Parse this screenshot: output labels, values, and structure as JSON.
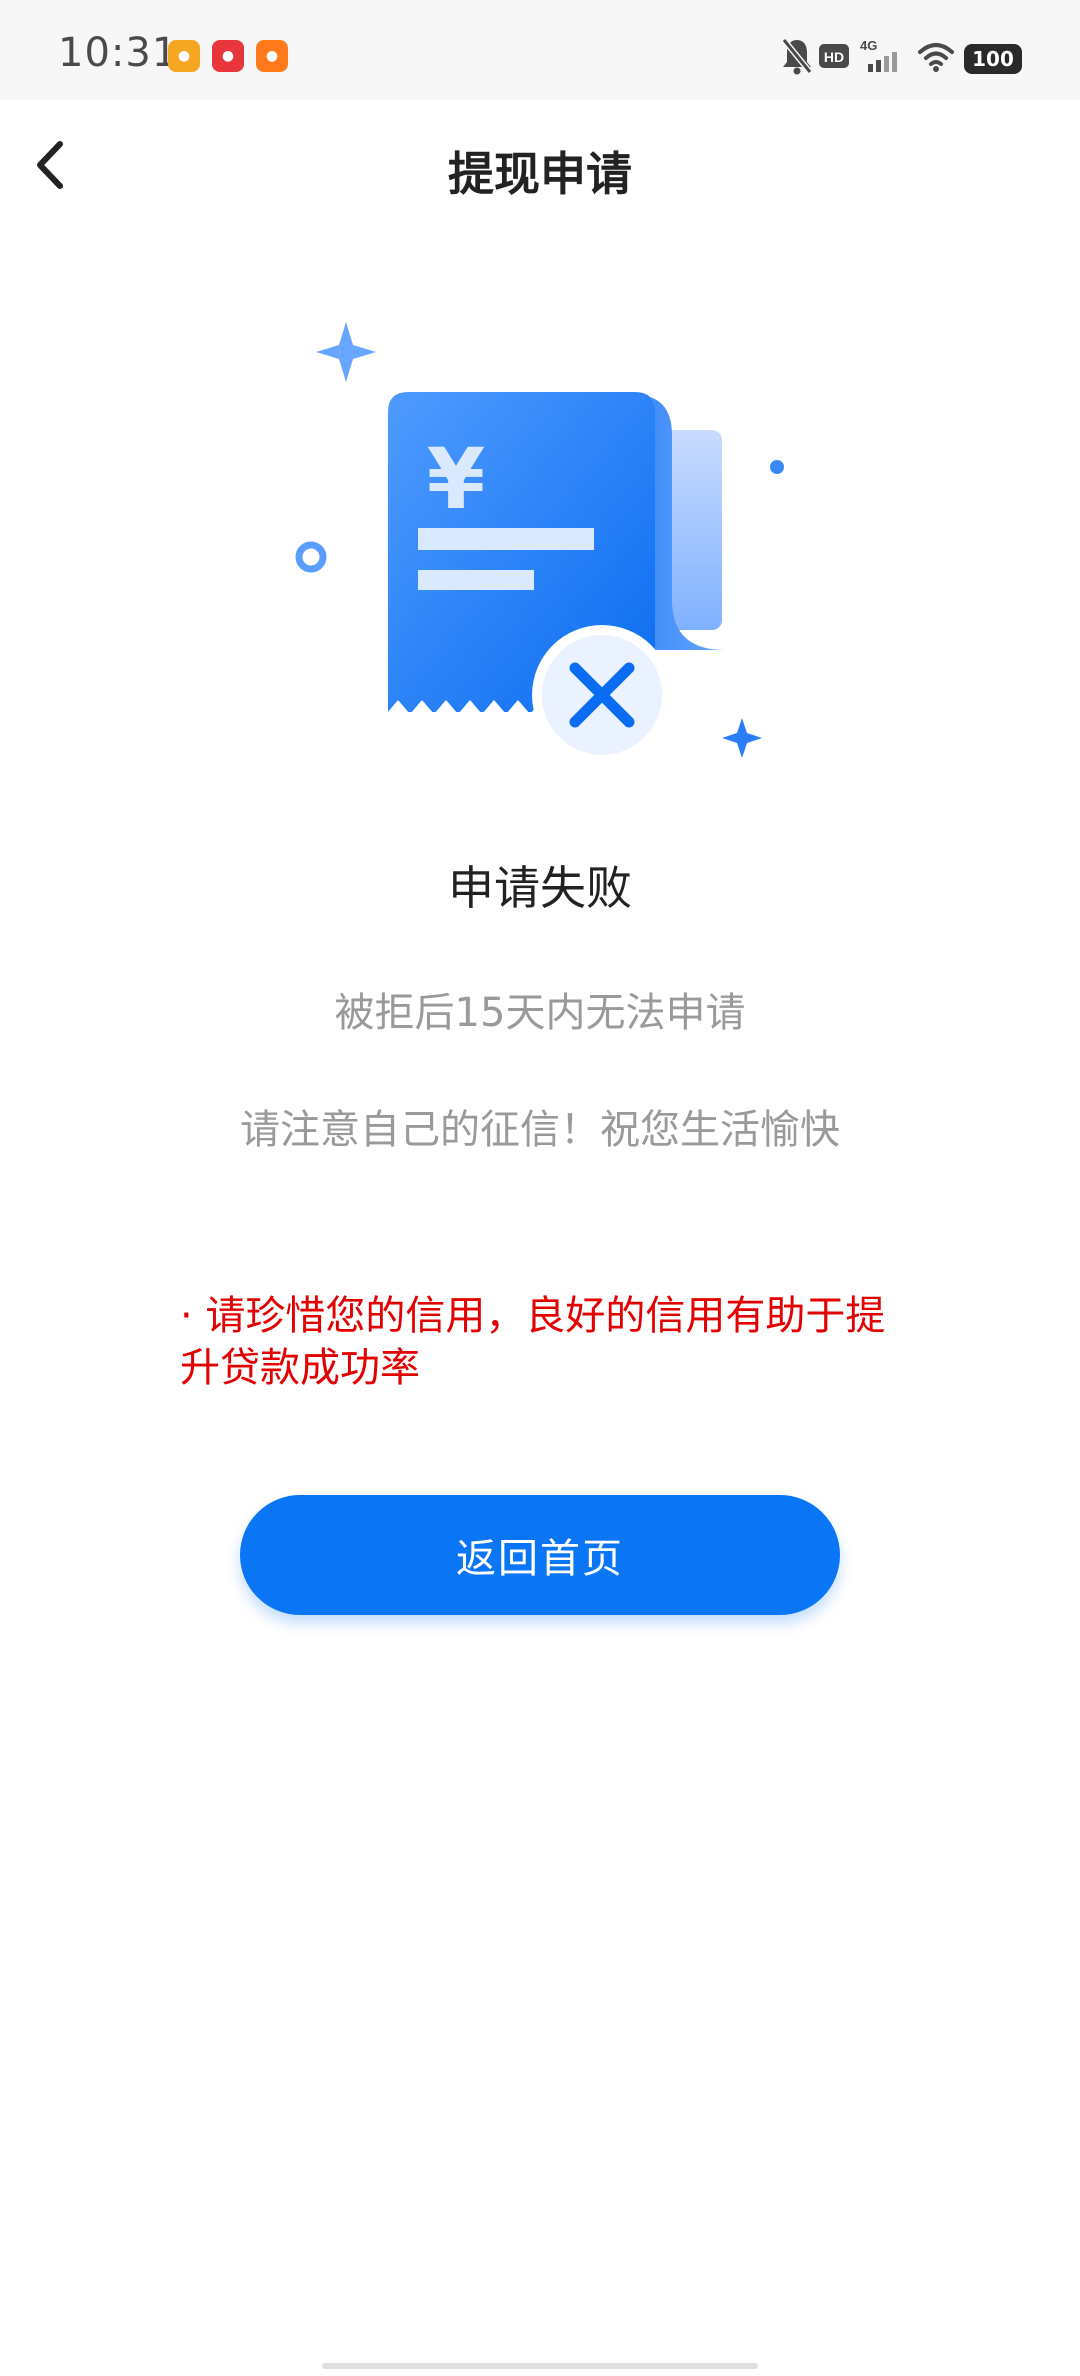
{
  "status_bar": {
    "time": "10:31",
    "battery": "100",
    "network": "4G"
  },
  "header": {
    "title": "提现申请"
  },
  "illustration": {
    "currency_symbol": "¥"
  },
  "result": {
    "headline": "申请失败",
    "line1": "被拒后15天内无法申请",
    "line2": "请注意自己的征信！祝您生活愉快"
  },
  "notice": {
    "text": "· 请珍惜您的信用，良好的信用有助于提升贷款成功率"
  },
  "actions": {
    "home_button": "返回首页"
  },
  "colors": {
    "primary": "#0a76f5",
    "warning": "#e30000",
    "muted": "#9a9a9a"
  }
}
